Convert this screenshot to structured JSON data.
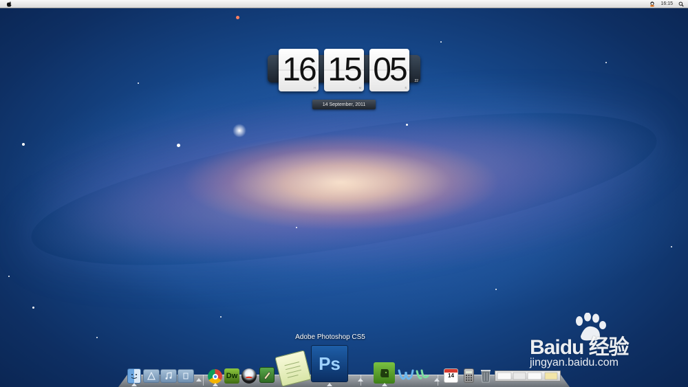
{
  "menubar": {
    "clock": "16:15",
    "icons": [
      "apple-icon",
      "user-status-icon",
      "spotlight-icon"
    ]
  },
  "clock_widget": {
    "hours": "16",
    "minutes": "15",
    "seconds_card": "05",
    "seconds": "22",
    "hour_label": "H",
    "minute_label": "M",
    "second_label": "S",
    "date": "14 September, 2011"
  },
  "dock": {
    "tooltip": "Adobe Photoshop CS5",
    "calendar_day": "14",
    "ps_label": "Ps",
    "dw_label": "Dw",
    "items": [
      "finder-icon",
      "applications-folder-icon",
      "music-folder-icon",
      "documents-folder-icon",
      "chrome-icon",
      "dreamweaver-icon",
      "qq-icon",
      "grab-icon",
      "textedit-icon",
      "photoshop-icon",
      "evernote-icon",
      "wifi-icon",
      "calendar-icon",
      "calculator-icon",
      "trash-icon",
      "stacks-icon"
    ]
  },
  "watermark": {
    "brand": "Bai",
    "brand_suffix": "du",
    "brand_cn": "经验",
    "url": "jingyan.baidu.com"
  }
}
